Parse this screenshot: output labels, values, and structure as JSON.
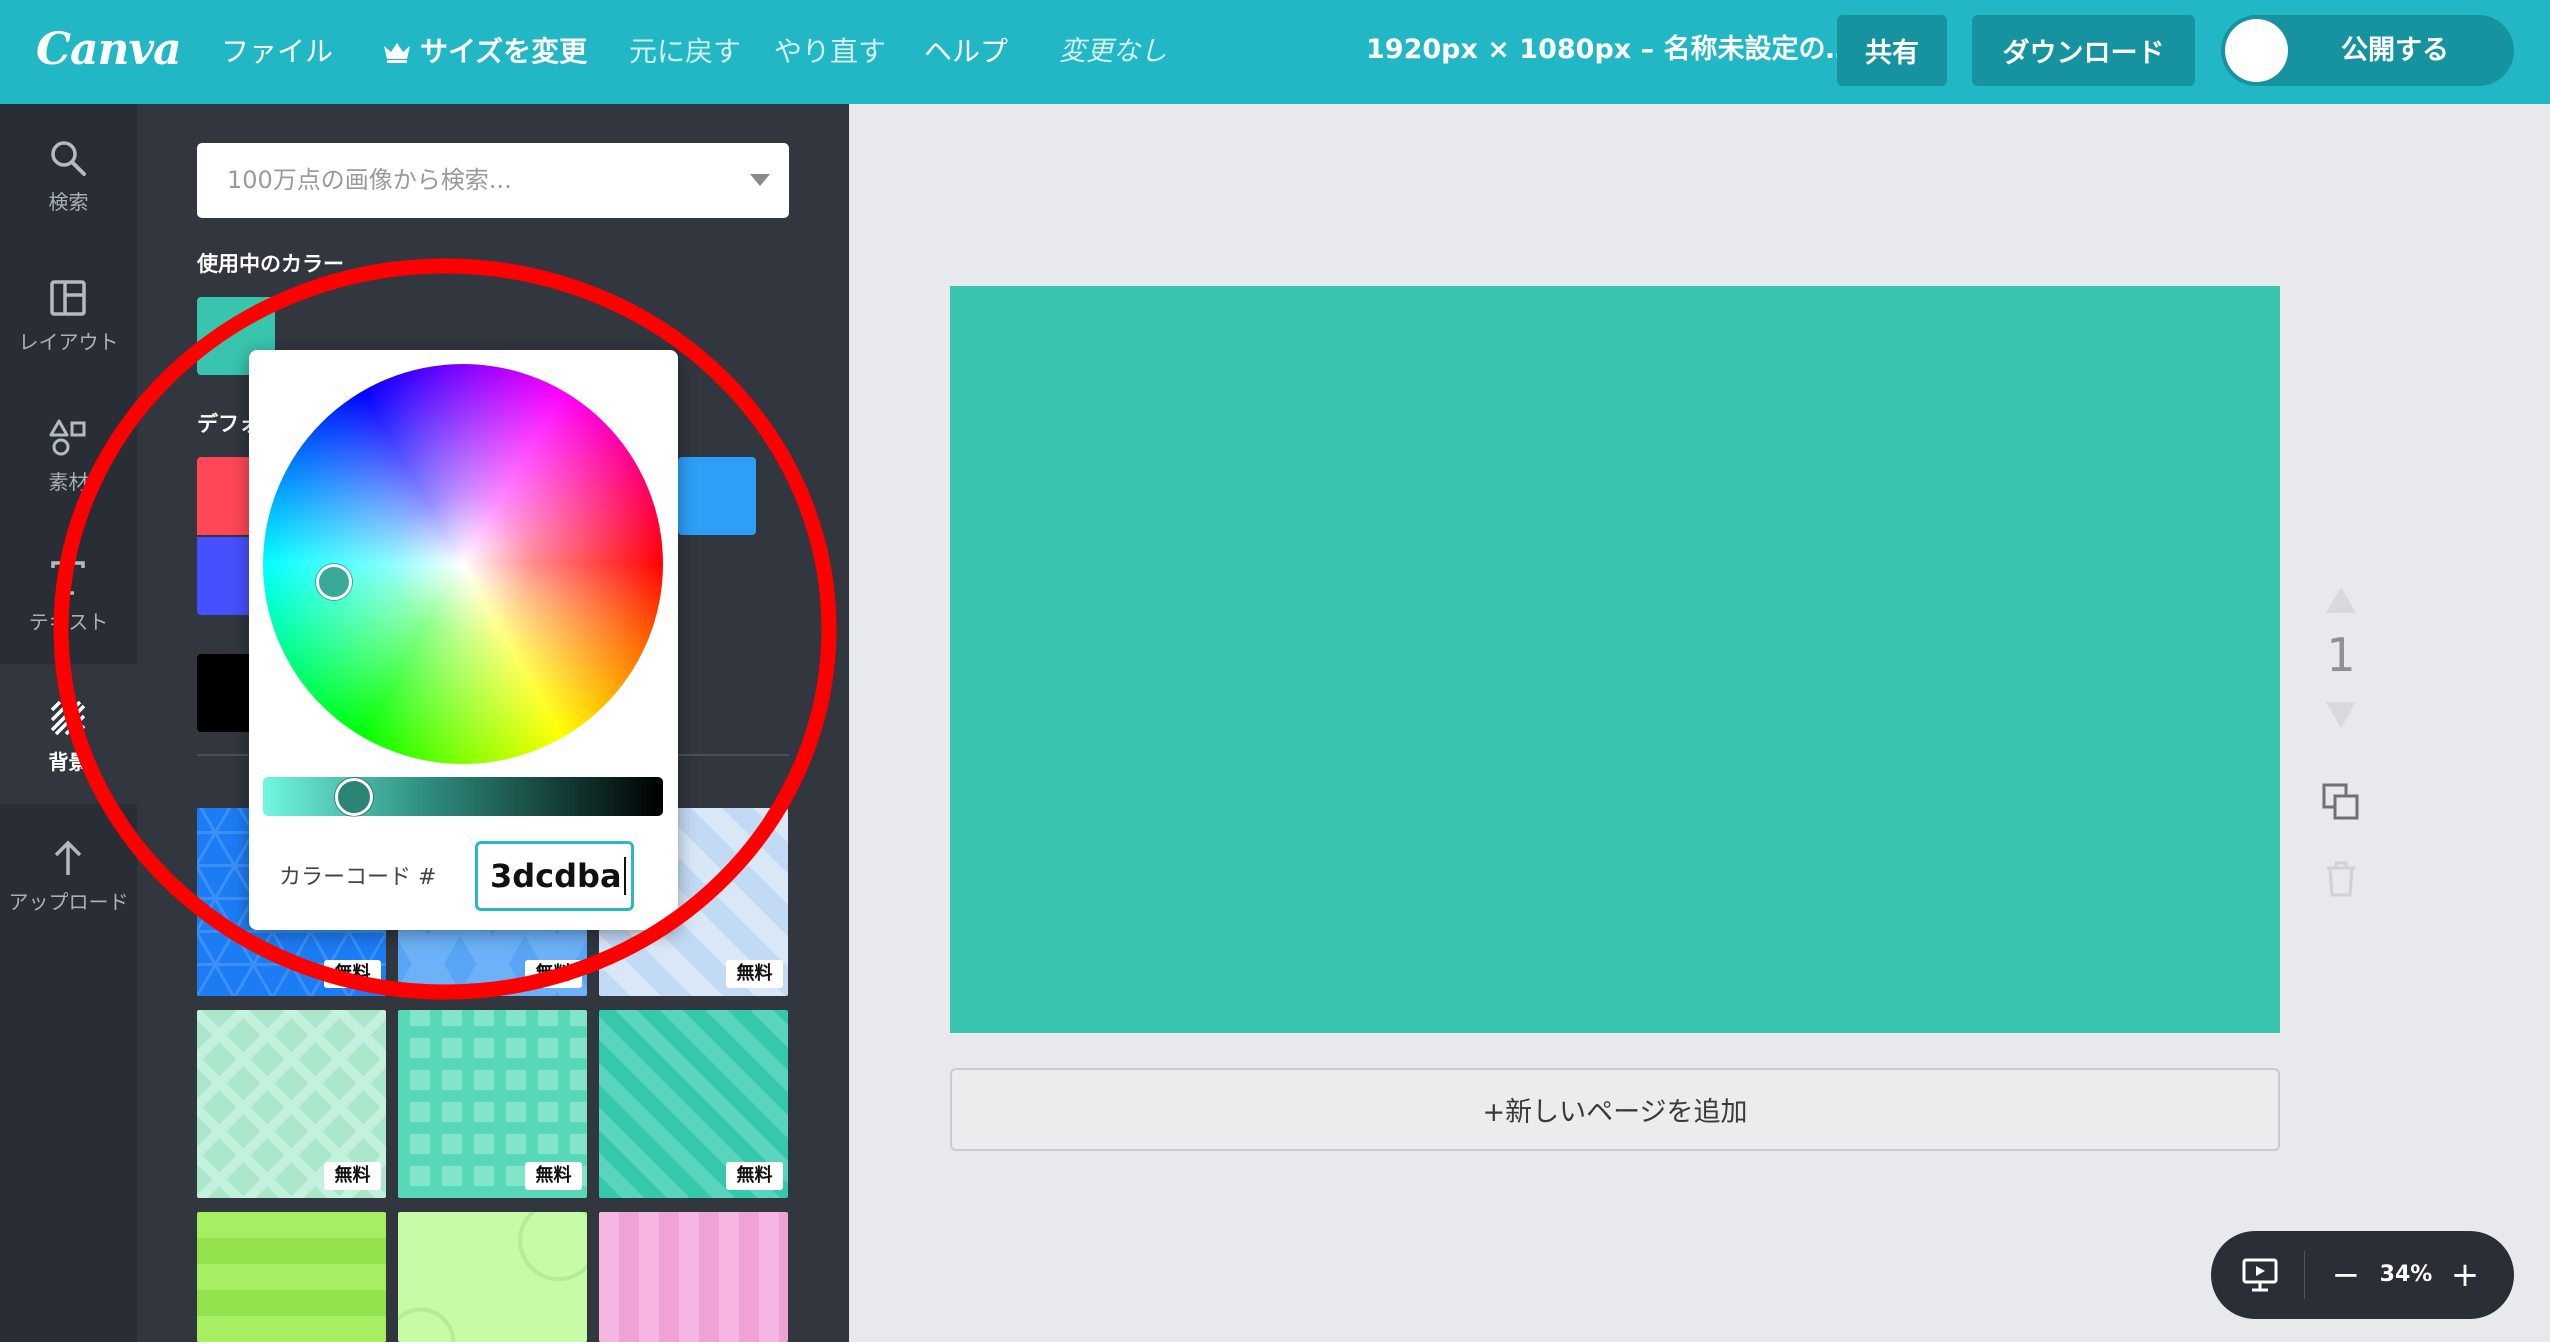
{
  "colors": {
    "accent": "#21b7c5",
    "header_button": "#16939e",
    "sidebar": "#292e36",
    "panel": "#31363f",
    "canvas_color": "#38c4ad",
    "code_border": "#2bb7c4",
    "annotation": "#ff0000"
  },
  "header": {
    "logo": "Canva",
    "menu": [
      {
        "label": "ファイル"
      },
      {
        "label": "サイズを変更",
        "icon": "crown-icon"
      },
      {
        "label": "元に戻す"
      },
      {
        "label": "やり直す"
      },
      {
        "label": "ヘルプ"
      }
    ],
    "save_status": "変更なし",
    "doc_title": "1920px × 1080px – 名称未設定の…",
    "share_label": "共有",
    "download_label": "ダウンロード",
    "publish_label": "公開する",
    "publish_toggle_on": false
  },
  "sidebar": {
    "items": [
      {
        "label": "検索",
        "icon": "search-icon"
      },
      {
        "label": "レイアウト",
        "icon": "layout-icon"
      },
      {
        "label": "素材",
        "icon": "shapes-icon"
      },
      {
        "label": "テキスト",
        "icon": "text-icon"
      },
      {
        "label": "背景",
        "icon": "background-icon",
        "active": true
      },
      {
        "label": "アップロード",
        "icon": "upload-icon"
      }
    ]
  },
  "panel": {
    "search_placeholder": "100万点の画像から検索...",
    "used_colors_label": "使用中のカラー",
    "used_colors": [
      "#38c4ad"
    ],
    "default_colors_label": "デフォ",
    "default_colors": [
      "#ff4757",
      "#2d9ff7",
      "#4650ff",
      "#000000"
    ],
    "backgrounds": [
      {
        "badge": "無料"
      },
      {
        "badge": "無料"
      },
      {
        "badge": "無料"
      },
      {
        "badge": "無料"
      },
      {
        "badge": "無料"
      },
      {
        "badge": "無料"
      }
    ]
  },
  "color_picker": {
    "code_label": "カラーコード #",
    "code_value": "3dcdba",
    "hue": 172,
    "saturation": 0.65,
    "shade": 0.2
  },
  "canvas": {
    "add_page_label": "+新しいページを追加",
    "page_number": "1"
  },
  "zoom": {
    "level": "34%",
    "zoom_out": "−",
    "zoom_in": "+"
  }
}
